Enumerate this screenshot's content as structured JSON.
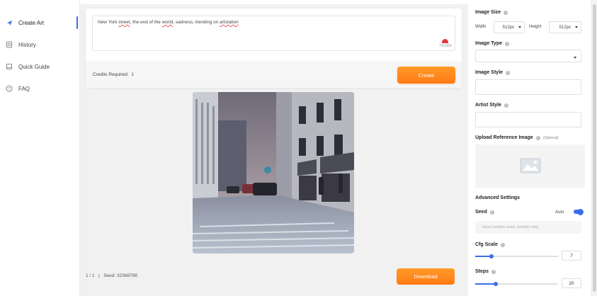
{
  "sidebar": {
    "items": [
      {
        "label": "Create Art",
        "icon": "send-icon"
      },
      {
        "label": "History",
        "icon": "history-icon"
      },
      {
        "label": "Quick Guide",
        "icon": "book-icon"
      },
      {
        "label": "FAQ",
        "icon": "question-icon"
      }
    ]
  },
  "prompt": {
    "value": "New York street, the end of the world, sadness, trending on artstation",
    "segments": [
      "New York ",
      "street",
      ", the end of the ",
      "world",
      ", sadness, trending on ",
      "artstation"
    ],
    "counter": "70/1000"
  },
  "credits": {
    "label": "Credits Required:",
    "value": "1"
  },
  "create_label": "Create",
  "result": {
    "page": "1 / 1",
    "separator": "|",
    "seed": "Seed: 32368798"
  },
  "download_label": "Download",
  "panel": {
    "image_size": {
      "label": "Image Size",
      "width_label": "Width",
      "width_value": "512px",
      "height_label": "Height",
      "height_value": "512px"
    },
    "image_type": {
      "label": "Image Type",
      "value": ""
    },
    "image_style": {
      "label": "Image Style",
      "value": ""
    },
    "artist_style": {
      "label": "Artist Style",
      "value": ""
    },
    "upload": {
      "label": "Upload Reference Image",
      "optional": "(Optional)"
    },
    "advanced": {
      "label": "Advanced Settings"
    },
    "seed": {
      "label": "Seed",
      "auto_label": "Auto",
      "placeholder": "Input random seed, number only.",
      "auto_enabled": true
    },
    "cfg_scale": {
      "label": "Cfg Scale",
      "value": "7",
      "fraction": 0.2
    },
    "steps": {
      "label": "Steps",
      "value": "20",
      "fraction": 0.25
    }
  },
  "colors": {
    "accent": "#3a6ee8",
    "button": "#ff8a1c"
  }
}
